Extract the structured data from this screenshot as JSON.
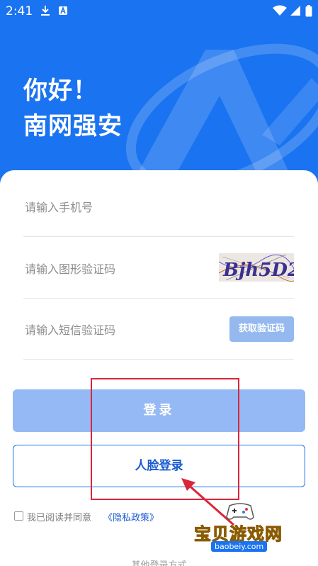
{
  "status_bar": {
    "time": "2:41"
  },
  "greeting": {
    "line1": "你好！",
    "line2": "南网强安"
  },
  "form": {
    "phone_placeholder": "请输入手机号",
    "captcha_placeholder": "请输入图形验证码",
    "captcha_image_text": "Bjh5D2",
    "sms_placeholder": "请输入短信验证码",
    "sms_button_label": "获取验证码"
  },
  "buttons": {
    "login_label": "登录",
    "face_login_label": "人脸登录"
  },
  "agreement": {
    "text": "我已阅读并同意",
    "policy_link": "《隐私政策》"
  },
  "other_login": {
    "label": "其他登录方式"
  },
  "watermark": {
    "title": "宝贝游戏网",
    "domain": "baobeiy.com"
  },
  "colors": {
    "brand_blue": "#1a73f0",
    "login_button_disabled": "#95b9f4",
    "sms_button": "#95b9ee",
    "annotation_red": "#d9263a"
  }
}
